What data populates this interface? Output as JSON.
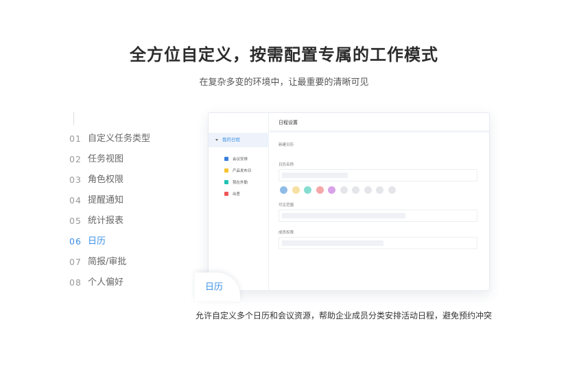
{
  "header": {
    "title": "全方位自定义，按需配置专属的工作模式",
    "subtitle": "在复杂多变的环境中，让最重要的清晰可见"
  },
  "menu": {
    "active_index": 5,
    "items": [
      {
        "num": "01",
        "label": "自定义任务类型"
      },
      {
        "num": "02",
        "label": "任务视图"
      },
      {
        "num": "03",
        "label": "角色权限"
      },
      {
        "num": "04",
        "label": "提醒通知"
      },
      {
        "num": "05",
        "label": "统计报表"
      },
      {
        "num": "06",
        "label": "日历"
      },
      {
        "num": "07",
        "label": "简报/审批"
      },
      {
        "num": "08",
        "label": "个人偏好"
      }
    ]
  },
  "preview": {
    "sidebar": {
      "group_label": "我的日程",
      "items": [
        {
          "label": "会议安排",
          "color": "#3b7fd9"
        },
        {
          "label": "产品发布日",
          "color": "#f5c231"
        },
        {
          "label": "我在外勤",
          "color": "#23c1b4"
        },
        {
          "label": "出差",
          "color": "#f0575b"
        }
      ]
    },
    "panel": {
      "title": "日程设置",
      "new_label": "新建日历",
      "name_label": "日历名称",
      "visibility_label": "可见范围",
      "member_label": "成员权限",
      "swatch_colors": [
        "#8fbbe8",
        "#f7e0a3",
        "#87ddd2",
        "#f6a8a9",
        "#d9a2e8",
        "#e5e6ea",
        "#e5e6ea",
        "#e5e6ea",
        "#e5e6ea",
        "#e5e6ea"
      ]
    }
  },
  "feature_tab": {
    "label": "日历"
  },
  "caption": "允许自定义多个日历和会议资源，帮助企业成员分类安排活动日程，避免预约冲突"
}
